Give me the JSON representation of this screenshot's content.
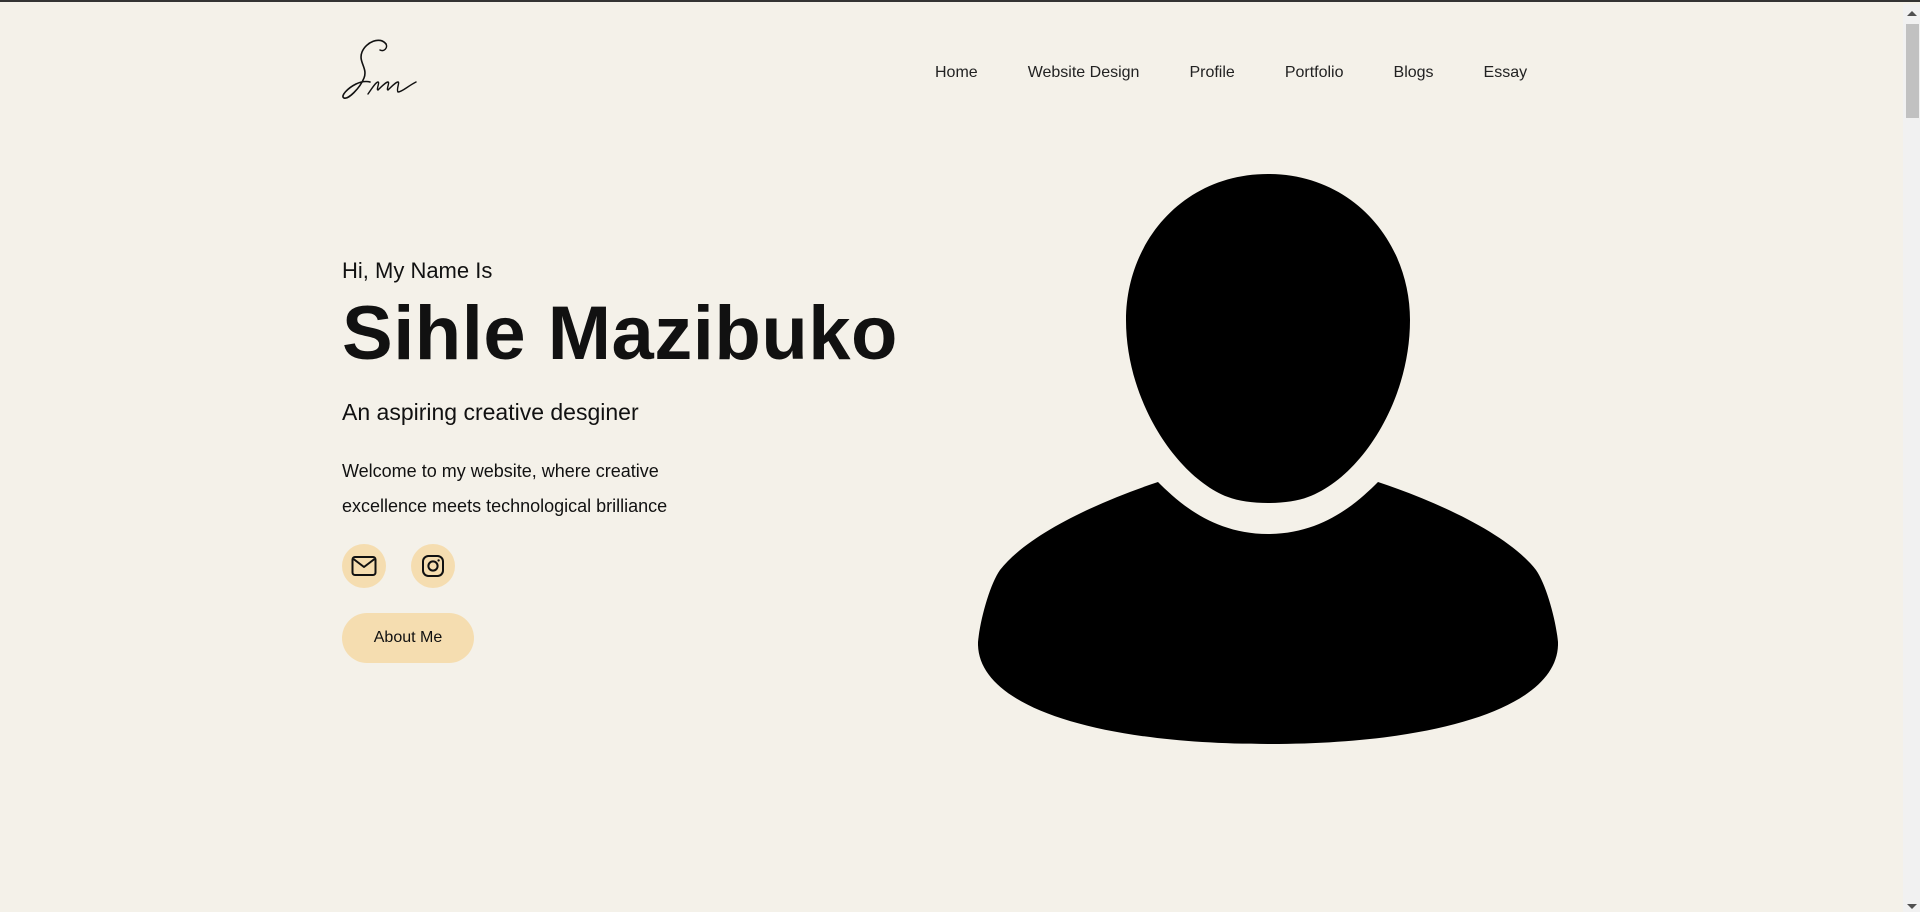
{
  "header": {
    "logo_text": "Sm",
    "nav": [
      {
        "label": "Home"
      },
      {
        "label": "Website Design"
      },
      {
        "label": "Profile"
      },
      {
        "label": "Portfolio"
      },
      {
        "label": "Blogs"
      },
      {
        "label": "Essay"
      }
    ]
  },
  "hero": {
    "greeting": "Hi, My Name Is",
    "name": "Sihle Mazibuko",
    "tagline": "An aspiring creative desginer",
    "intro": "Welcome to my website, where creative excellence meets technological brilliance",
    "socials": [
      {
        "icon": "mail-icon"
      },
      {
        "icon": "instagram-icon"
      }
    ],
    "about_button": "About Me"
  },
  "colors": {
    "background": "#f4f1e9",
    "accent": "#f5ddb0",
    "text": "#111111"
  }
}
